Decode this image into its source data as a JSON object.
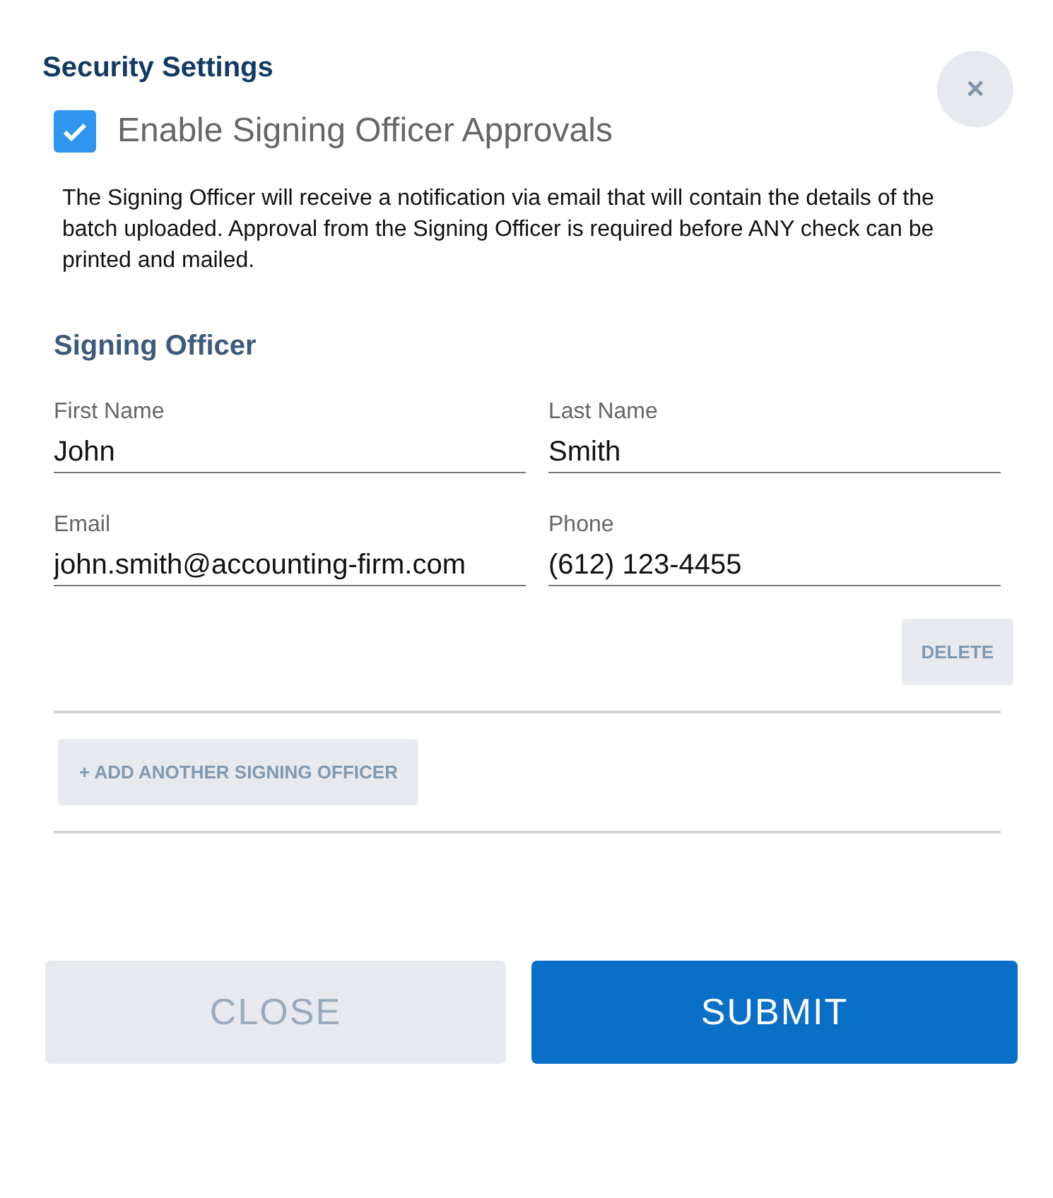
{
  "title": "Security Settings",
  "close_icon_button": {
    "label": "×"
  },
  "enable_approvals": {
    "label": "Enable Signing Officer Approvals",
    "checked": true
  },
  "description": "The Signing Officer will receive a notification via email that will contain the details of the batch uploaded. Approval from the Signing Officer is required before ANY check can be printed and mailed.",
  "section_title": "Signing Officer",
  "fields": [
    {
      "label": "First Name",
      "value": "John"
    },
    {
      "label": "Last Name",
      "value": "Smith"
    },
    {
      "label": "Email",
      "value": "john.smith@accounting-firm.com"
    },
    {
      "label": "Phone",
      "value": "(612) 123-4455"
    }
  ],
  "delete_button": "DELETE",
  "add_button": "+ ADD ANOTHER SIGNING OFFICER",
  "buttons": [
    {
      "label": "CLOSE",
      "kind": "secondary"
    },
    {
      "label": "SUBMIT",
      "kind": "primary"
    }
  ]
}
